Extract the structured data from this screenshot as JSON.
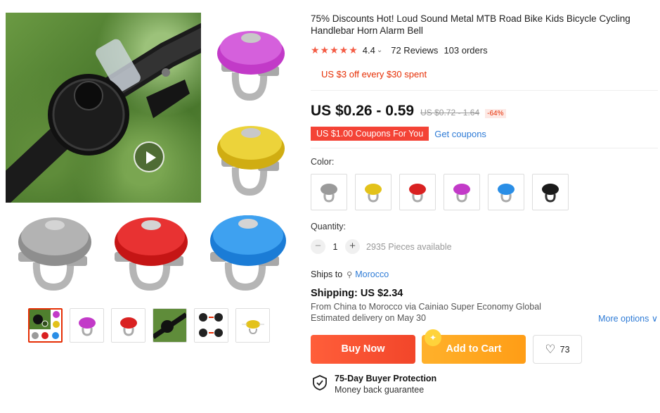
{
  "product": {
    "title": "75% Discounts Hot! Loud Sound Metal MTB Road Bike Kids Bicycle Cycling Handlebar Horn Alarm Bell",
    "stars": "★★★★★",
    "rating": "4.4",
    "reviews": "72 Reviews",
    "orders": "103 orders",
    "promo": "US $3 off every $30 spent",
    "price": "US $0.26 - 0.59",
    "old_price": "US $0.72 - 1.64",
    "discount": "-64%",
    "coupon_tag": "US $1.00 Coupons For You",
    "get_coupons": "Get coupons"
  },
  "color": {
    "label": "Color:",
    "options": [
      {
        "name": "silver",
        "hex": "#9a9a9a"
      },
      {
        "name": "gold",
        "hex": "#e3c21a"
      },
      {
        "name": "red",
        "hex": "#d92121"
      },
      {
        "name": "purple",
        "hex": "#c23ac8"
      },
      {
        "name": "blue",
        "hex": "#2a8ee6"
      },
      {
        "name": "black",
        "hex": "#1a1a1a"
      }
    ]
  },
  "quantity": {
    "label": "Quantity:",
    "minus": "−",
    "plus": "+",
    "value": "1",
    "available": "2935 Pieces available"
  },
  "shipping": {
    "ships_to": "Ships to",
    "country": "Morocco",
    "cost": "Shipping: US $2.34",
    "route": "From China to Morocco via Cainiao Super Economy Global",
    "delivery": "Estimated delivery on May 30",
    "more_options": "More options ∨"
  },
  "actions": {
    "buy_now": "Buy Now",
    "add_to_cart": "Add to Cart",
    "wishlist_count": "73"
  },
  "protection": {
    "title": "75-Day Buyer Protection",
    "subtitle": "Money back guarantee"
  },
  "gallery": {
    "tiles": [
      {
        "name": "purple",
        "hex": "#c23ac8"
      },
      {
        "name": "gold",
        "hex": "#e3c21a"
      },
      {
        "name": "silver",
        "hex": "#9a9a9a"
      },
      {
        "name": "red",
        "hex": "#d92121"
      },
      {
        "name": "blue",
        "hex": "#2a8ee6"
      }
    ],
    "thumbnails": [
      "collage",
      "purple",
      "red",
      "lifestyle",
      "instructions",
      "gold-diagram"
    ]
  }
}
